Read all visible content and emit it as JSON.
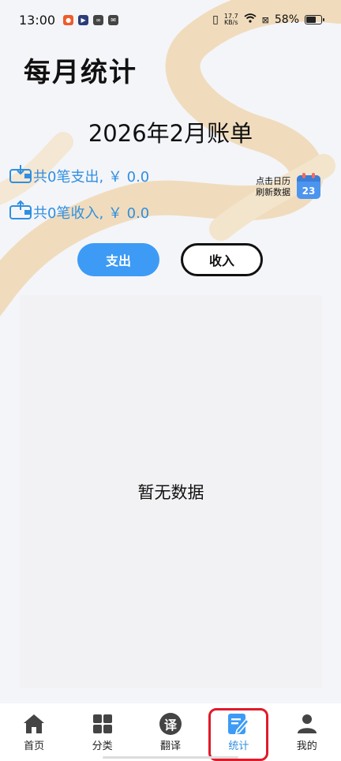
{
  "status_bar": {
    "time": "13:00",
    "net_speed_value": "17.7",
    "net_speed_unit": "KB/s",
    "battery": "58%"
  },
  "page": {
    "title": "每月统计",
    "bill_title": "2026年2月账单"
  },
  "summary": {
    "expense": "共0笔支出, ￥ 0.0",
    "income": "共0笔收入, ￥ 0.0"
  },
  "refresh": {
    "line1": "点击日历",
    "line2": "刷新数据",
    "calendar_day": "23"
  },
  "tabs": {
    "expense": "支出",
    "income": "收入"
  },
  "chart": {
    "empty_text": "暂无数据"
  },
  "nav": {
    "items": [
      {
        "label": "首页",
        "icon": "home-icon"
      },
      {
        "label": "分类",
        "icon": "grid-icon"
      },
      {
        "label": "翻译",
        "icon": "translate-icon",
        "glyph": "译"
      },
      {
        "label": "统计",
        "icon": "statistics-icon",
        "active": true
      },
      {
        "label": "我的",
        "icon": "profile-icon"
      }
    ]
  },
  "colors": {
    "accent": "#3d9bf5",
    "summary_text": "#2f8fe0",
    "background_swirl": "#f0dcbd",
    "highlight": "#e01a2a"
  }
}
